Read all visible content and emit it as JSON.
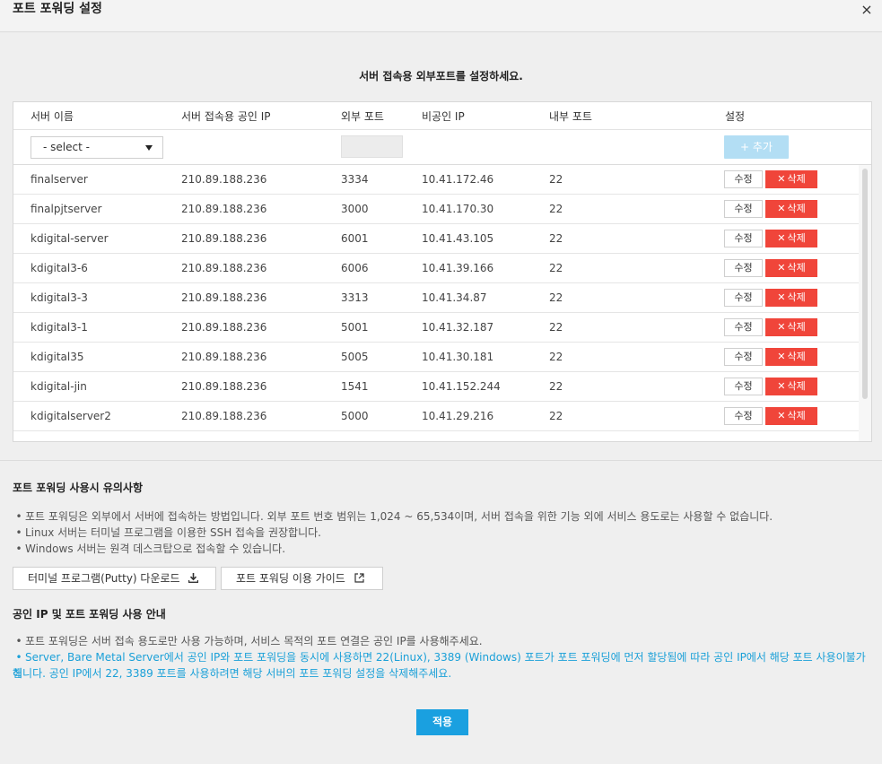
{
  "dialog": {
    "title": "포트 포워딩 설정",
    "close_label": "×"
  },
  "subtitle": "서버 접속용 외부포트를 설정하세요.",
  "table": {
    "headers": [
      "서버 이름",
      "서버 접속용 공인 IP",
      "외부 포트",
      "비공인 IP",
      "내부 포트",
      "설정"
    ],
    "filter": {
      "select_value": "- select -",
      "port_value": "",
      "add_label": "+ 추가"
    },
    "edit_label": "수정",
    "delete_label": "삭제",
    "rows": [
      {
        "name": "finalserver",
        "public_ip": "210.89.188.236",
        "ext_port": "3334",
        "private_ip": "10.41.172.46",
        "int_port": "22"
      },
      {
        "name": "finalpjtserver",
        "public_ip": "210.89.188.236",
        "ext_port": "3000",
        "private_ip": "10.41.170.30",
        "int_port": "22"
      },
      {
        "name": "kdigital-server",
        "public_ip": "210.89.188.236",
        "ext_port": "6001",
        "private_ip": "10.41.43.105",
        "int_port": "22"
      },
      {
        "name": "kdigital3-6",
        "public_ip": "210.89.188.236",
        "ext_port": "6006",
        "private_ip": "10.41.39.166",
        "int_port": "22"
      },
      {
        "name": "kdigital3-3",
        "public_ip": "210.89.188.236",
        "ext_port": "3313",
        "private_ip": "10.41.34.87",
        "int_port": "22"
      },
      {
        "name": "kdigital3-1",
        "public_ip": "210.89.188.236",
        "ext_port": "5001",
        "private_ip": "10.41.32.187",
        "int_port": "22"
      },
      {
        "name": "kdigital35",
        "public_ip": "210.89.188.236",
        "ext_port": "5005",
        "private_ip": "10.41.30.181",
        "int_port": "22"
      },
      {
        "name": "kdigital-jin",
        "public_ip": "210.89.188.236",
        "ext_port": "1541",
        "private_ip": "10.41.152.244",
        "int_port": "22"
      },
      {
        "name": "kdigitalserver2",
        "public_ip": "210.89.188.236",
        "ext_port": "5000",
        "private_ip": "10.41.29.216",
        "int_port": "22"
      }
    ]
  },
  "notice1": {
    "title": "포트 포워딩 사용시 유의사항",
    "items": [
      "포트 포워딩은 외부에서 서버에 접속하는 방법입니다. 외부 포트 번호 범위는 1,024 ~ 65,534이며, 서버 접속을 위한 기능 외에 서비스 용도로는 사용할 수 없습니다.",
      "Linux 서버는 터미널 프로그램을 이용한 SSH 접속을 권장합니다.",
      "Windows 서버는 원격 데스크탑으로 접속할 수 있습니다."
    ],
    "download_label": "터미널 프로그램(Putty) 다운로드",
    "guide_label": "포트 포워딩 이용 가이드"
  },
  "notice2": {
    "title": "공인 IP 및 포트 포워딩 사용 안내",
    "items": [
      "포트 포워딩은 서버 접속 용도로만 사용 가능하며, 서비스 목적의 포트 연결은 공인 IP를 사용해주세요."
    ],
    "highlight_line1": "Server, Bare Metal Server에서 공인 IP와 포트 포워딩을 동시에 사용하면 22(Linux), 3389 (Windows) 포트가 포트 포워딩에 먼저 할당됨에 따라 공인 IP에서 해당 포트 사용이불가해",
    "highlight_line2": "집니다. 공인 IP에서 22, 3389 포트를 사용하려면 해당 서버의 포트 포워딩 설정을 삭제해주세요."
  },
  "apply_label": "적용",
  "colors": {
    "accent": "#1aa0e0",
    "delete": "#f0453a",
    "add_disabled": "#b3def4",
    "highlight_text": "#1aa0d8"
  }
}
